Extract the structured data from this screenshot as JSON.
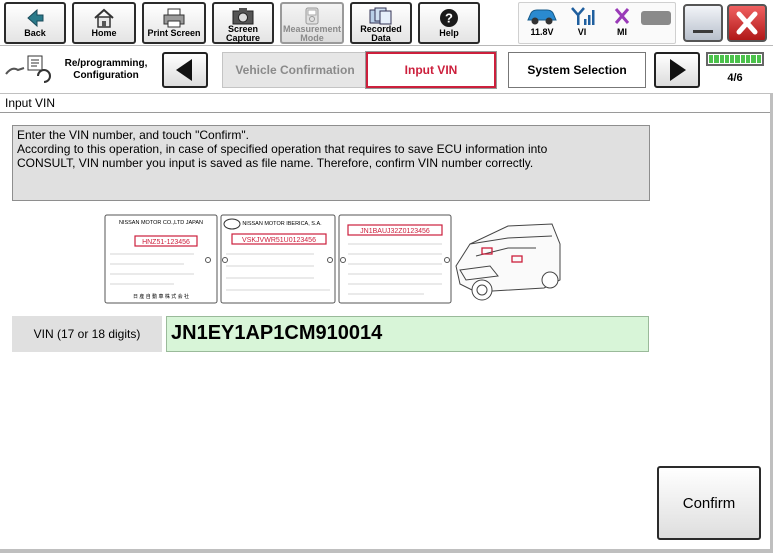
{
  "toolbar": {
    "back_label": "Back",
    "home_label": "Home",
    "print_label": "Print Screen",
    "capture_label": "Screen Capture",
    "measurement_label": "Measurement Mode",
    "recorded_label": "Recorded Data",
    "help_label": "Help"
  },
  "status": {
    "voltage": "11.8V",
    "vi_label": "VI",
    "mi_label": "MI"
  },
  "nav": {
    "mode_label": "Re/programming, Configuration",
    "steps": [
      {
        "label": "Vehicle Confirmation"
      },
      {
        "label": "Input VIN"
      },
      {
        "label": "System Selection"
      }
    ],
    "page_indicator": "4/6",
    "battery_level": 1.0
  },
  "section_title": "Input VIN",
  "instructions": {
    "line1": "Enter the VIN number, and touch \"Confirm\".",
    "line2": "According to this operation, in case of specified operation that requires to save ECU information into",
    "line3": "CONSULT, VIN number you input is saved as file name. Therefore, confirm VIN number correctly."
  },
  "plates": {
    "plate1_maker": "NISSAN MOTOR CO.,LTD JAPAN",
    "plate1_code": "HNZ51-123456",
    "plate1_footer": "日 産 自 動 車 株 式 会 社",
    "plate2_maker": "NISSAN MOTOR IBERICA, S.A.",
    "plate2_code": "VSKJVWR51U0123456",
    "plate3_code": "JN1BAUJ32Z0123456"
  },
  "vin": {
    "label": "VIN (17 or 18 digits)",
    "value": "JN1EY1AP1CM910014"
  },
  "confirm_label": "Confirm",
  "colors": {
    "accent_red": "#cc1f3c",
    "vin_field_bg": "#d8f5d8",
    "battery_green": "#4cc24c"
  }
}
